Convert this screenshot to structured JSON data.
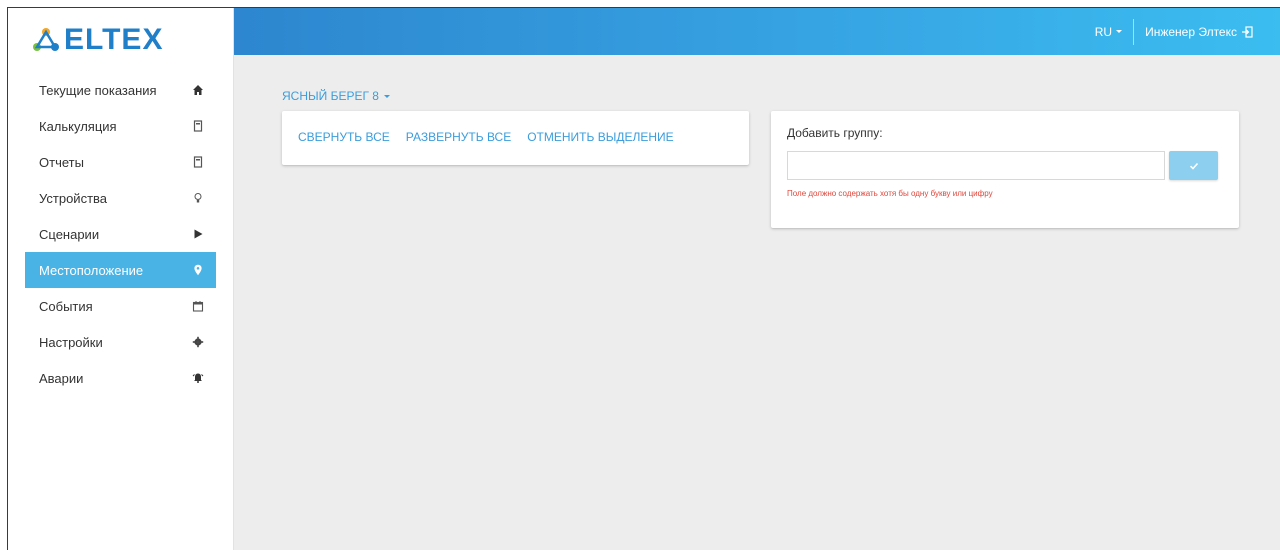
{
  "brand": {
    "logo_text": "ELTEX",
    "accent": "#4ab3e6",
    "logo_color": "#1f7fc9"
  },
  "sidebar": {
    "items": [
      {
        "label": "Текущие показания",
        "icon": "home-icon",
        "active": false
      },
      {
        "label": "Калькуляция",
        "icon": "calculator-icon",
        "active": false
      },
      {
        "label": "Отчеты",
        "icon": "report-icon",
        "active": false
      },
      {
        "label": "Устройства",
        "icon": "lightbulb-icon",
        "active": false
      },
      {
        "label": "Сценарии",
        "icon": "play-icon",
        "active": false
      },
      {
        "label": "Местоположение",
        "icon": "map-marker-icon",
        "active": true
      },
      {
        "label": "События",
        "icon": "calendar-icon",
        "active": false
      },
      {
        "label": "Настройки",
        "icon": "gear-icon",
        "active": false
      },
      {
        "label": "Аварии",
        "icon": "alarm-bell-icon",
        "active": false
      }
    ]
  },
  "header": {
    "language": "RU",
    "user_name": "Инженер Элтекс",
    "gradient_start": "#2d86cf",
    "gradient_end": "#3bbdf0"
  },
  "location": {
    "selected": "ЯСНЫЙ БЕРЕГ 8"
  },
  "tree_actions": {
    "collapse_all": "СВЕРНУТЬ ВСЕ",
    "expand_all": "РАЗВЕРНУТЬ ВСЕ",
    "deselect": "ОТМЕНИТЬ ВЫДЕЛЕНИЕ"
  },
  "add_group": {
    "label": "Добавить группу:",
    "value": "",
    "placeholder": "",
    "error": "Поле должно содержать хотя бы одну букву или цифру",
    "submit_icon": "check-icon",
    "error_color": "#e0463b"
  }
}
